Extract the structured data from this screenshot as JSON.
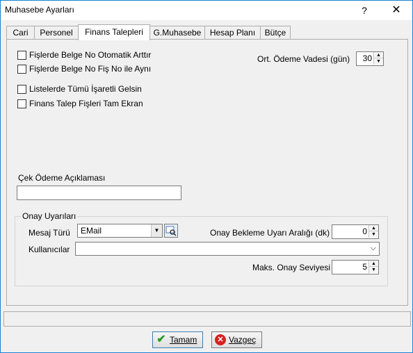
{
  "window": {
    "title": "Muhasebe Ayarları",
    "help_glyph": "?",
    "close_glyph": "✕"
  },
  "tabs": [
    {
      "label": "Cari"
    },
    {
      "label": "Personel"
    },
    {
      "label": "Finans Talepleri",
      "active": true
    },
    {
      "label": "G.Muhasebe"
    },
    {
      "label": "Hesap Planı"
    },
    {
      "label": "Bütçe"
    }
  ],
  "options": {
    "cb1": {
      "label": "Fişlerde Belge No Otomatik Arttır",
      "checked": false
    },
    "cb2": {
      "label": "Fişlerde Belge No Fiş No ile Aynı",
      "checked": false
    },
    "cb3": {
      "label": "Listelerde Tümü İşaretli Gelsin",
      "checked": false
    },
    "cb4": {
      "label": "Finans Talep Fişleri Tam Ekran",
      "checked": false
    }
  },
  "payment_term": {
    "label": "Ort. Ödeme Vadesi (gün)",
    "value": "30"
  },
  "check_payment": {
    "label": "Çek Ödeme Açıklaması",
    "value": ""
  },
  "approval": {
    "group_title": "Onay Uyarıları",
    "message_type_label": "Mesaj Türü",
    "message_type_value": "EMail",
    "wait_interval_label": "Onay Bekleme Uyarı Aralığı (dk)",
    "wait_interval_value": "0",
    "users_label": "Kullanıcılar",
    "users_value": "",
    "max_level_label": "Maks. Onay Seviyesi",
    "max_level_value": "5"
  },
  "buttons": {
    "ok_label": "Tamam",
    "cancel_label": "Vazgeç"
  }
}
